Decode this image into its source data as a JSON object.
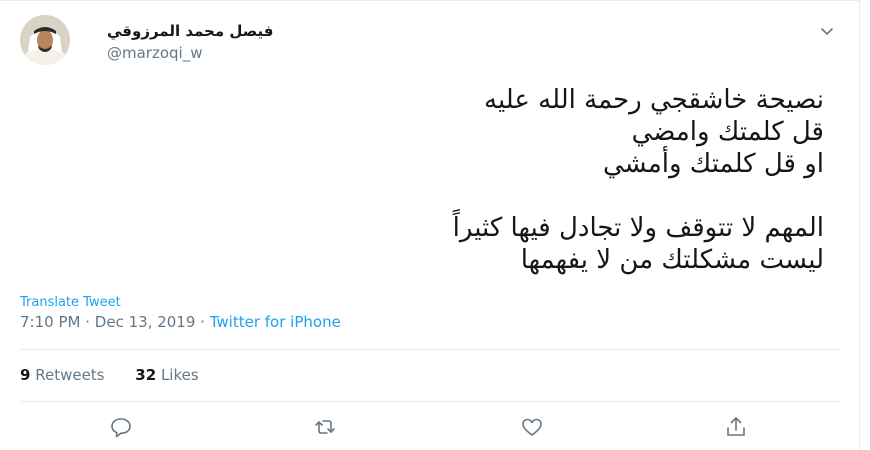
{
  "user": {
    "name": "فيصل محمد المرزوقي",
    "handle": "@marzoqi_w"
  },
  "tweet": {
    "lines": [
      "نصيحة خاشقجي رحمة الله عليه",
      "قل كلمتك وامضي",
      "او قل كلمتك وأمشي",
      "",
      "المهم لا تتوقف ولا تجادل فيها كثيراً",
      "ليست مشكلتك من لا يفهمها"
    ]
  },
  "translate_label": "Translate Tweet",
  "meta": {
    "time": "7:10 PM",
    "separator1": "·",
    "date": "Dec 13, 2019",
    "separator2": "·",
    "source": "Twitter for iPhone"
  },
  "stats": {
    "retweets_count": "9",
    "retweets_label": "Retweets",
    "likes_count": "32",
    "likes_label": "Likes"
  },
  "icons": {
    "reply": "reply-icon",
    "retweet": "retweet-icon",
    "like": "heart-icon",
    "share": "share-icon",
    "caret": "chevron-down-icon"
  },
  "colors": {
    "link": "#1da1f2",
    "secondary_text": "#657786",
    "primary_text": "#14171a",
    "divider": "#e6ecf0"
  }
}
